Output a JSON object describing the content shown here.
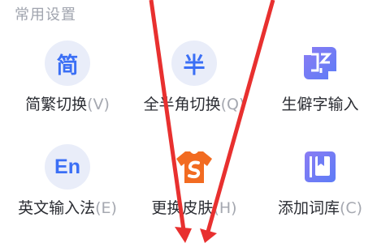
{
  "section": {
    "title": "常用设置"
  },
  "items": [
    {
      "name": "简繁切换",
      "shortcut": "(V)",
      "icon": "简",
      "icon_name": "simplified-traditional-icon"
    },
    {
      "name": "全半角切换",
      "shortcut": "(Q)",
      "icon": "半",
      "icon_name": "half-width-icon"
    },
    {
      "name": "生僻字输入",
      "shortcut": "",
      "icon": "",
      "icon_name": "rare-character-icon"
    },
    {
      "name": "英文输入法",
      "shortcut": "(E)",
      "icon": "En",
      "icon_name": "english-input-icon"
    },
    {
      "name": "更换皮肤",
      "shortcut": "(H)",
      "icon": "",
      "icon_name": "skin-shirt-icon"
    },
    {
      "name": "添加词库",
      "shortcut": "(C)",
      "icon": "",
      "icon_name": "dictionary-icon"
    }
  ],
  "colors": {
    "accent": "#3b6ff5",
    "icon_bg": "#e9edf9",
    "title_gray": "#a0a4ae",
    "arrow_red": "#e8302f",
    "shirt_orange": "#f26b21"
  }
}
